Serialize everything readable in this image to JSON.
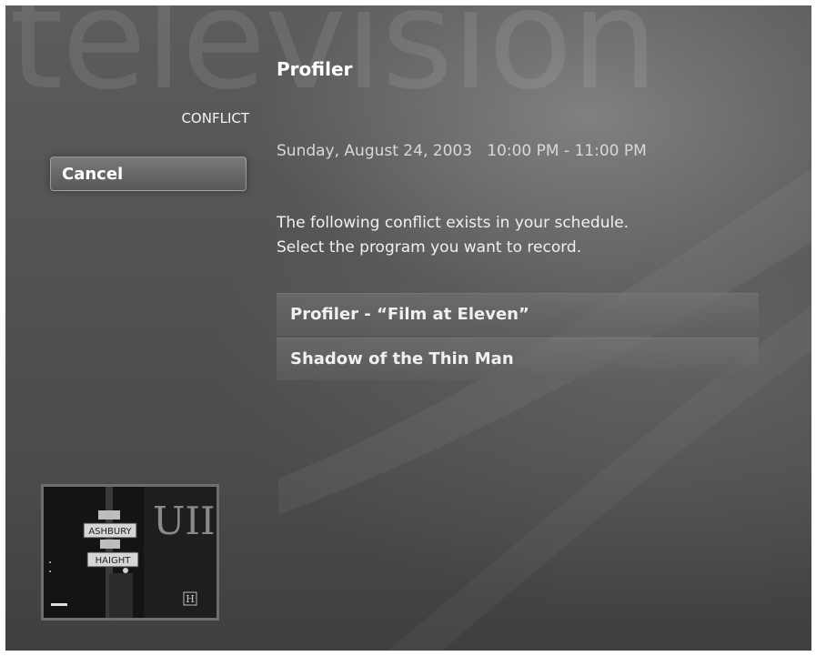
{
  "background": {
    "watermark_text": "television"
  },
  "header": {
    "title": "Profiler"
  },
  "sidebar": {
    "section_label": "CONFLICT",
    "cancel_label": "Cancel"
  },
  "main": {
    "date": "Sunday, August 24, 2003",
    "time_range": "10:00 PM - 11:00 PM",
    "message_line1": "The following conflict exists in your schedule.",
    "message_line2": "Select the program you want to record.",
    "programs": [
      {
        "label": "Profiler - “Film at Eleven”"
      },
      {
        "label": "Shadow of the Thin Man"
      }
    ]
  },
  "preview": {
    "sign_top": "ASHBURY",
    "sign_bottom": "HAIGHT",
    "channel_logo": "H",
    "background_text": "UII"
  },
  "colors": {
    "background": "#525252",
    "text": "#f2f2f2",
    "list_item": "#6e6e6e"
  }
}
